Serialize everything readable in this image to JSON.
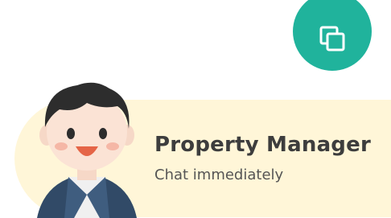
{
  "copy_button": {
    "icon": "copy-icon",
    "color": "#20b39c"
  },
  "chat_card": {
    "title": "Property Manager",
    "subtitle": "Chat immediately",
    "background": "#fff6d8"
  }
}
